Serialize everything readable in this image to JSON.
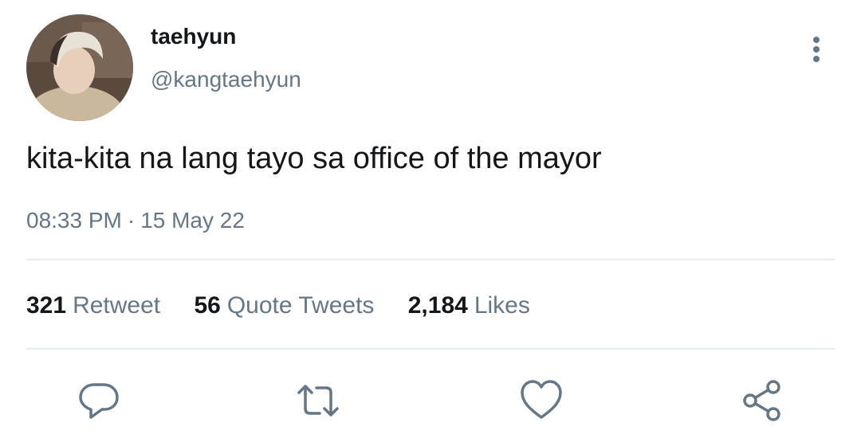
{
  "author": {
    "display_name": "taehyun",
    "handle": "@kangtaehyun"
  },
  "tweet": {
    "text": "kita-kita na lang tayo sa office of the mayor",
    "time": "08:33 PM",
    "separator": "·",
    "date": "15 May 22"
  },
  "stats": [
    {
      "count": "321",
      "label": "Retweet"
    },
    {
      "count": "56",
      "label": "Quote Tweets"
    },
    {
      "count": "2,184",
      "label": "Likes"
    }
  ],
  "icons": {
    "more": "more-vertical-icon",
    "reply": "reply-icon",
    "retweet": "retweet-icon",
    "like": "heart-icon",
    "share": "share-icon"
  },
  "colors": {
    "text_primary": "#14171a",
    "text_secondary": "#657786",
    "divider": "#e6ecf0",
    "icon": "#657786"
  }
}
